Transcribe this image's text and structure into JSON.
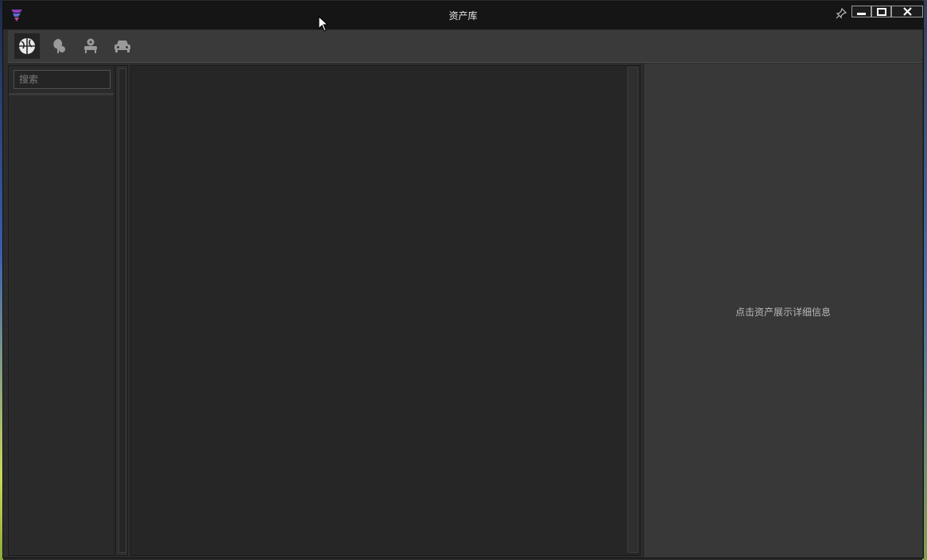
{
  "window": {
    "title": "资产库"
  },
  "toolbar": {
    "tabs": [
      {
        "icon": "globe-icon",
        "active": true
      },
      {
        "icon": "tree-icon",
        "active": false
      },
      {
        "icon": "armchair-icon",
        "active": false
      },
      {
        "icon": "car-icon",
        "active": false
      }
    ]
  },
  "sidebar": {
    "search_placeholder": "搜索"
  },
  "detail": {
    "hint": "点击资产展示详细信息"
  },
  "colors": {
    "titlebar": "#151515",
    "panel": "#2d2d2d",
    "detail_bg": "#383838",
    "accent_logo": "#8a3fbf"
  }
}
